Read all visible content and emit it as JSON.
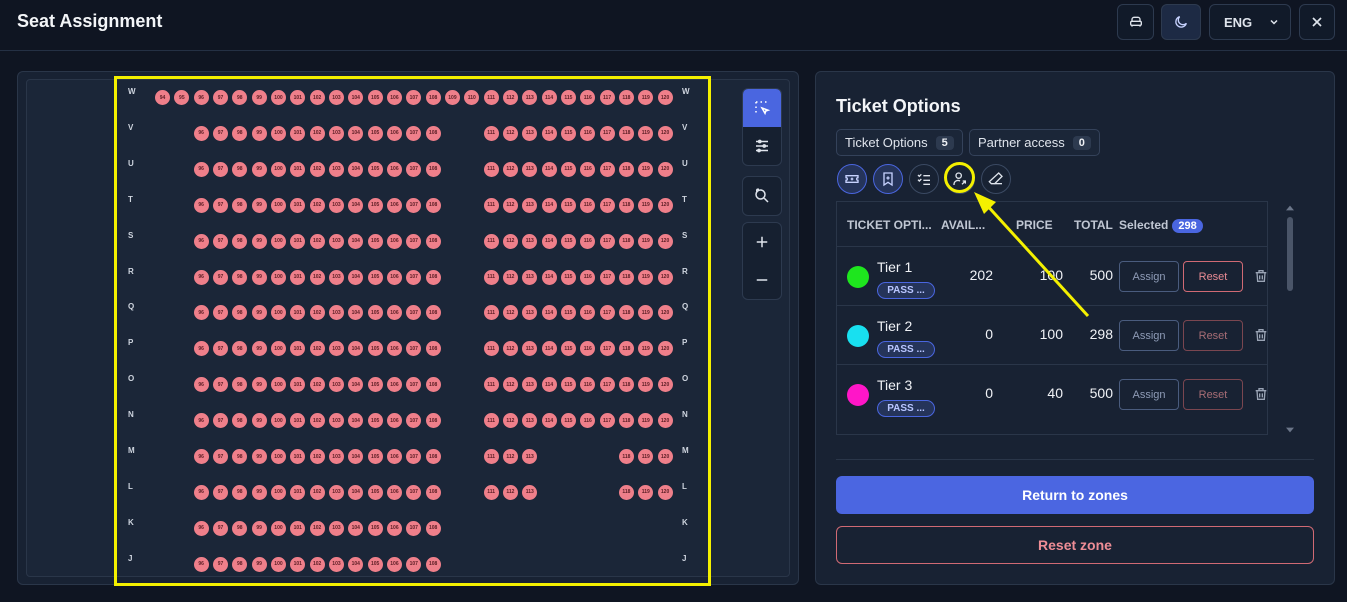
{
  "app": {
    "title": "Seat Assignment"
  },
  "header": {
    "language": "ENG"
  },
  "seatmap": {
    "rows": [
      "W",
      "V",
      "U",
      "T",
      "S",
      "R",
      "Q",
      "P",
      "O",
      "N",
      "M",
      "L",
      "K",
      "J"
    ],
    "rowW": [
      "94",
      "95",
      "96",
      "97",
      "98",
      "99",
      "100",
      "101",
      "102",
      "103",
      "104",
      "105",
      "106",
      "107",
      "108",
      "109",
      "110",
      "111",
      "112",
      "113",
      "114",
      "115",
      "116",
      "117",
      "118",
      "119",
      "120"
    ],
    "leftBlock": [
      "96",
      "97",
      "98",
      "99",
      "100",
      "101",
      "102",
      "103",
      "104",
      "105",
      "106",
      "107",
      "108"
    ],
    "rightBlock": [
      "111",
      "112",
      "113",
      "114",
      "115",
      "116",
      "117",
      "118",
      "119",
      "120"
    ],
    "partialLeftRight": [
      "111",
      "112",
      "113"
    ],
    "partialRightRight": [
      "118",
      "119",
      "120"
    ]
  },
  "ticket_panel": {
    "title": "Ticket Options",
    "tabs": [
      {
        "label": "Ticket Options",
        "count": "5"
      },
      {
        "label": "Partner access",
        "count": "0"
      }
    ],
    "columns": {
      "name": "TICKET OPTI...",
      "available": "AVAIL...",
      "price": "PRICE",
      "total": "TOTAL",
      "selected": "Selected",
      "selected_count": "298"
    },
    "rows": [
      {
        "name": "Tier 1",
        "tag": "PASS ...",
        "available": "202",
        "price": "100",
        "total": "500",
        "color": "#1ee61e"
      },
      {
        "name": "Tier 2",
        "tag": "PASS ...",
        "available": "0",
        "price": "100",
        "total": "298",
        "color": "#18e0f0"
      },
      {
        "name": "Tier 3",
        "tag": "PASS ...",
        "available": "0",
        "price": "40",
        "total": "500",
        "color": "#ff16c8"
      }
    ],
    "assign_label": "Assign",
    "reset_label": "Reset",
    "return_label": "Return to zones",
    "reset_zone_label": "Reset zone"
  },
  "colors": {
    "accent": "#4b66e1",
    "seat": "#ef7f8a",
    "highlight": "#f4f000"
  }
}
